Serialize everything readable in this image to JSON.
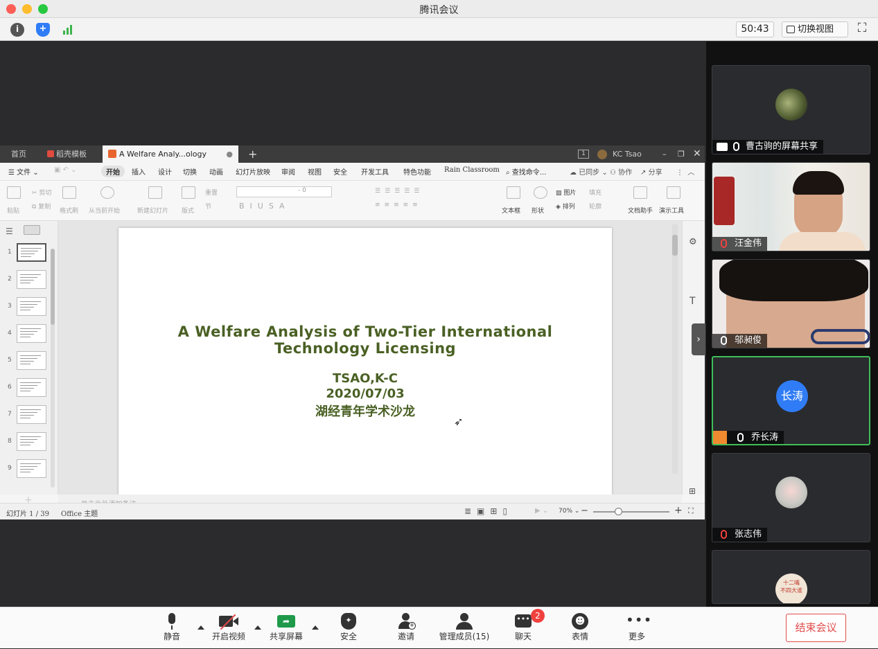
{
  "window": {
    "title": "腾讯会议"
  },
  "topbar": {
    "timer": "50:43",
    "switch_view": "切换视图"
  },
  "wps": {
    "tabs": [
      {
        "label": "首页"
      },
      {
        "label": "稻壳模板"
      },
      {
        "label": "A Welfare Analy...ology Licensing"
      }
    ],
    "tab_add": "+",
    "user": "KC Tsao",
    "page_badge": "1",
    "menu": {
      "file": "文件",
      "items": [
        "开始",
        "插入",
        "设计",
        "切换",
        "动画",
        "幻灯片放映",
        "审阅",
        "视图",
        "安全",
        "开发工具",
        "特色功能",
        "Rain Classroom"
      ],
      "search": "查找命令...",
      "sync": "已同步",
      "collab": "协作",
      "share": "分享"
    },
    "ribbon": {
      "paste": "粘贴",
      "cut": "剪切",
      "copy": "复制",
      "format_painter": "格式刷",
      "from_current": "从当前开始",
      "new_slide": "新建幻灯片",
      "layout": "版式",
      "reset": "重置",
      "section": "节",
      "font_size": "0",
      "textbox": "文本框",
      "shape": "形状",
      "picture": "图片",
      "fill": "填充",
      "arrange": "排列",
      "outline": "轮廓",
      "doc_assistant": "文档助手",
      "present_tools": "演示工具"
    },
    "slide": {
      "title_line1": "A Welfare Analysis of Two-Tier International",
      "title_line2": "Technology Licensing",
      "author": "TSAO,K-C",
      "date": "2020/07/03",
      "venue": "湖经青年学术沙龙"
    },
    "thumbnails": [
      "1",
      "2",
      "3",
      "4",
      "5",
      "6",
      "7",
      "8",
      "9"
    ],
    "notes_placeholder": "单击此处添加备注",
    "status": {
      "slide_count": "幻灯片 1 / 39",
      "theme": "Office 主题",
      "zoom": "70%"
    }
  },
  "participants": [
    {
      "name": "曹古驹的屏幕共享",
      "mic": "on"
    },
    {
      "name": "汪金伟",
      "mic": "muted"
    },
    {
      "name": "邬昶俊",
      "mic": "on"
    },
    {
      "name": "乔长涛",
      "mic": "on",
      "avatar_text": "长涛",
      "speaking": true
    },
    {
      "name": "张志伟",
      "mic": "muted"
    },
    {
      "name": "",
      "avatar_text": "不四大谁",
      "avatar_text2": "十二嘴"
    }
  ],
  "toolbar": {
    "mute": "静音",
    "video": "开启视频",
    "share": "共享屏幕",
    "security": "安全",
    "invite": "邀请",
    "members": "管理成员(15)",
    "chat": "聊天",
    "chat_badge": "2",
    "reactions": "表情",
    "more": "更多",
    "end": "结束会议"
  },
  "colors": {
    "accent_green": "#4a6024",
    "end_red": "#e24b4b",
    "speaking_border": "#3fbf5a",
    "avatar_blue": "#2f7cf6"
  }
}
